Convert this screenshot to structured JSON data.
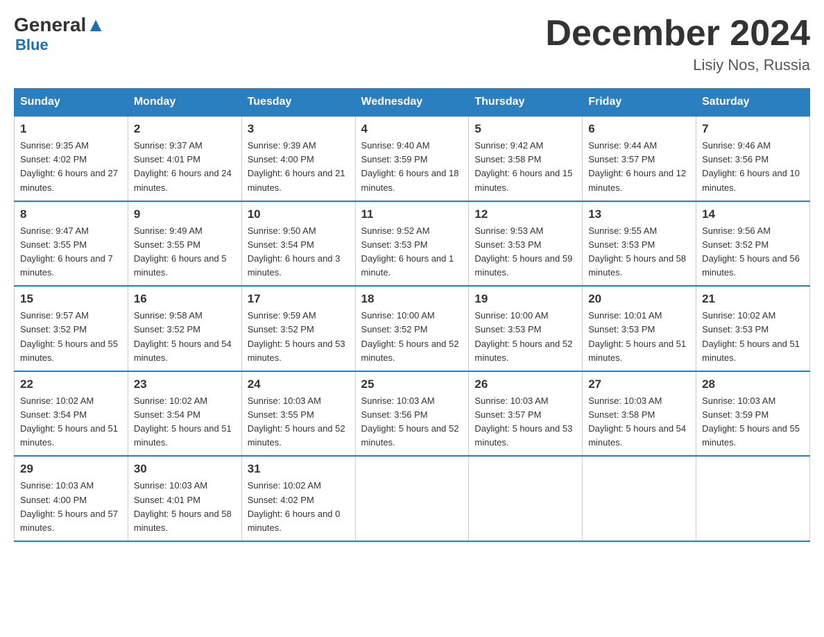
{
  "header": {
    "logo_general": "General",
    "logo_blue": "Blue",
    "month_title": "December 2024",
    "location": "Lisiy Nos, Russia"
  },
  "days_of_week": [
    "Sunday",
    "Monday",
    "Tuesday",
    "Wednesday",
    "Thursday",
    "Friday",
    "Saturday"
  ],
  "weeks": [
    [
      {
        "day": "1",
        "sunrise": "9:35 AM",
        "sunset": "4:02 PM",
        "daylight": "6 hours and 27 minutes."
      },
      {
        "day": "2",
        "sunrise": "9:37 AM",
        "sunset": "4:01 PM",
        "daylight": "6 hours and 24 minutes."
      },
      {
        "day": "3",
        "sunrise": "9:39 AM",
        "sunset": "4:00 PM",
        "daylight": "6 hours and 21 minutes."
      },
      {
        "day": "4",
        "sunrise": "9:40 AM",
        "sunset": "3:59 PM",
        "daylight": "6 hours and 18 minutes."
      },
      {
        "day": "5",
        "sunrise": "9:42 AM",
        "sunset": "3:58 PM",
        "daylight": "6 hours and 15 minutes."
      },
      {
        "day": "6",
        "sunrise": "9:44 AM",
        "sunset": "3:57 PM",
        "daylight": "6 hours and 12 minutes."
      },
      {
        "day": "7",
        "sunrise": "9:46 AM",
        "sunset": "3:56 PM",
        "daylight": "6 hours and 10 minutes."
      }
    ],
    [
      {
        "day": "8",
        "sunrise": "9:47 AM",
        "sunset": "3:55 PM",
        "daylight": "6 hours and 7 minutes."
      },
      {
        "day": "9",
        "sunrise": "9:49 AM",
        "sunset": "3:55 PM",
        "daylight": "6 hours and 5 minutes."
      },
      {
        "day": "10",
        "sunrise": "9:50 AM",
        "sunset": "3:54 PM",
        "daylight": "6 hours and 3 minutes."
      },
      {
        "day": "11",
        "sunrise": "9:52 AM",
        "sunset": "3:53 PM",
        "daylight": "6 hours and 1 minute."
      },
      {
        "day": "12",
        "sunrise": "9:53 AM",
        "sunset": "3:53 PM",
        "daylight": "5 hours and 59 minutes."
      },
      {
        "day": "13",
        "sunrise": "9:55 AM",
        "sunset": "3:53 PM",
        "daylight": "5 hours and 58 minutes."
      },
      {
        "day": "14",
        "sunrise": "9:56 AM",
        "sunset": "3:52 PM",
        "daylight": "5 hours and 56 minutes."
      }
    ],
    [
      {
        "day": "15",
        "sunrise": "9:57 AM",
        "sunset": "3:52 PM",
        "daylight": "5 hours and 55 minutes."
      },
      {
        "day": "16",
        "sunrise": "9:58 AM",
        "sunset": "3:52 PM",
        "daylight": "5 hours and 54 minutes."
      },
      {
        "day": "17",
        "sunrise": "9:59 AM",
        "sunset": "3:52 PM",
        "daylight": "5 hours and 53 minutes."
      },
      {
        "day": "18",
        "sunrise": "10:00 AM",
        "sunset": "3:52 PM",
        "daylight": "5 hours and 52 minutes."
      },
      {
        "day": "19",
        "sunrise": "10:00 AM",
        "sunset": "3:53 PM",
        "daylight": "5 hours and 52 minutes."
      },
      {
        "day": "20",
        "sunrise": "10:01 AM",
        "sunset": "3:53 PM",
        "daylight": "5 hours and 51 minutes."
      },
      {
        "day": "21",
        "sunrise": "10:02 AM",
        "sunset": "3:53 PM",
        "daylight": "5 hours and 51 minutes."
      }
    ],
    [
      {
        "day": "22",
        "sunrise": "10:02 AM",
        "sunset": "3:54 PM",
        "daylight": "5 hours and 51 minutes."
      },
      {
        "day": "23",
        "sunrise": "10:02 AM",
        "sunset": "3:54 PM",
        "daylight": "5 hours and 51 minutes."
      },
      {
        "day": "24",
        "sunrise": "10:03 AM",
        "sunset": "3:55 PM",
        "daylight": "5 hours and 52 minutes."
      },
      {
        "day": "25",
        "sunrise": "10:03 AM",
        "sunset": "3:56 PM",
        "daylight": "5 hours and 52 minutes."
      },
      {
        "day": "26",
        "sunrise": "10:03 AM",
        "sunset": "3:57 PM",
        "daylight": "5 hours and 53 minutes."
      },
      {
        "day": "27",
        "sunrise": "10:03 AM",
        "sunset": "3:58 PM",
        "daylight": "5 hours and 54 minutes."
      },
      {
        "day": "28",
        "sunrise": "10:03 AM",
        "sunset": "3:59 PM",
        "daylight": "5 hours and 55 minutes."
      }
    ],
    [
      {
        "day": "29",
        "sunrise": "10:03 AM",
        "sunset": "4:00 PM",
        "daylight": "5 hours and 57 minutes."
      },
      {
        "day": "30",
        "sunrise": "10:03 AM",
        "sunset": "4:01 PM",
        "daylight": "5 hours and 58 minutes."
      },
      {
        "day": "31",
        "sunrise": "10:02 AM",
        "sunset": "4:02 PM",
        "daylight": "6 hours and 0 minutes."
      },
      null,
      null,
      null,
      null
    ]
  ]
}
